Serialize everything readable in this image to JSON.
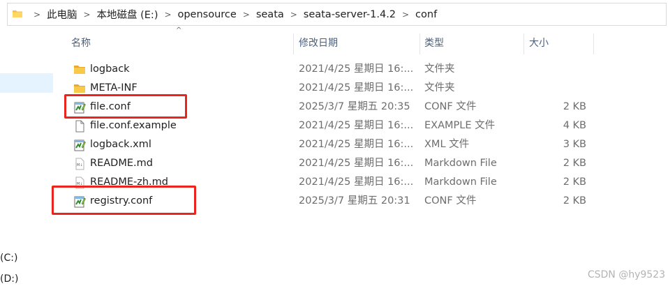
{
  "address_bar": {
    "breadcrumbs": [
      "此电脑",
      "本地磁盘 (E:)",
      "opensource",
      "seata",
      "seata-server-1.4.2",
      "conf"
    ]
  },
  "nav_pane": {
    "drives": [
      "(C:)",
      "(D:)"
    ]
  },
  "columns": {
    "name": "名称",
    "date": "修改日期",
    "type": "类型",
    "size": "大小"
  },
  "files": [
    {
      "name": "logback",
      "date": "2021/4/25 星期日 16:...",
      "type": "文件夹",
      "size": "",
      "icon": "folder-icon"
    },
    {
      "name": "META-INF",
      "date": "2021/4/25 星期日 16:...",
      "type": "文件夹",
      "size": "",
      "icon": "folder-icon"
    },
    {
      "name": "file.conf",
      "date": "2025/3/7 星期五 20:35",
      "type": "CONF 文件",
      "size": "2 KB",
      "icon": "notepad-file-icon"
    },
    {
      "name": "file.conf.example",
      "date": "2021/4/25 星期日 16:...",
      "type": "EXAMPLE 文件",
      "size": "4 KB",
      "icon": "blank-file-icon"
    },
    {
      "name": "logback.xml",
      "date": "2021/4/25 星期日 16:...",
      "type": "XML 文件",
      "size": "3 KB",
      "icon": "notepad-file-icon"
    },
    {
      "name": "README.md",
      "date": "2021/4/25 星期日 16:...",
      "type": "Markdown File",
      "size": "2 KB",
      "icon": "markdown-file-icon"
    },
    {
      "name": "README-zh.md",
      "date": "2021/4/25 星期日 16:...",
      "type": "Markdown File",
      "size": "2 KB",
      "icon": "markdown-file-icon"
    },
    {
      "name": "registry.conf",
      "date": "2025/3/7 星期五 20:31",
      "type": "CONF 文件",
      "size": "2 KB",
      "icon": "notepad-file-icon"
    }
  ],
  "highlighted_files": [
    "file.conf",
    "registry.conf"
  ],
  "watermark": "CSDN @hy9523",
  "colors": {
    "highlight": "#e8261d",
    "header_text": "#4c607a",
    "folder": "#f3c14b",
    "selection": "#e5f3ff"
  }
}
